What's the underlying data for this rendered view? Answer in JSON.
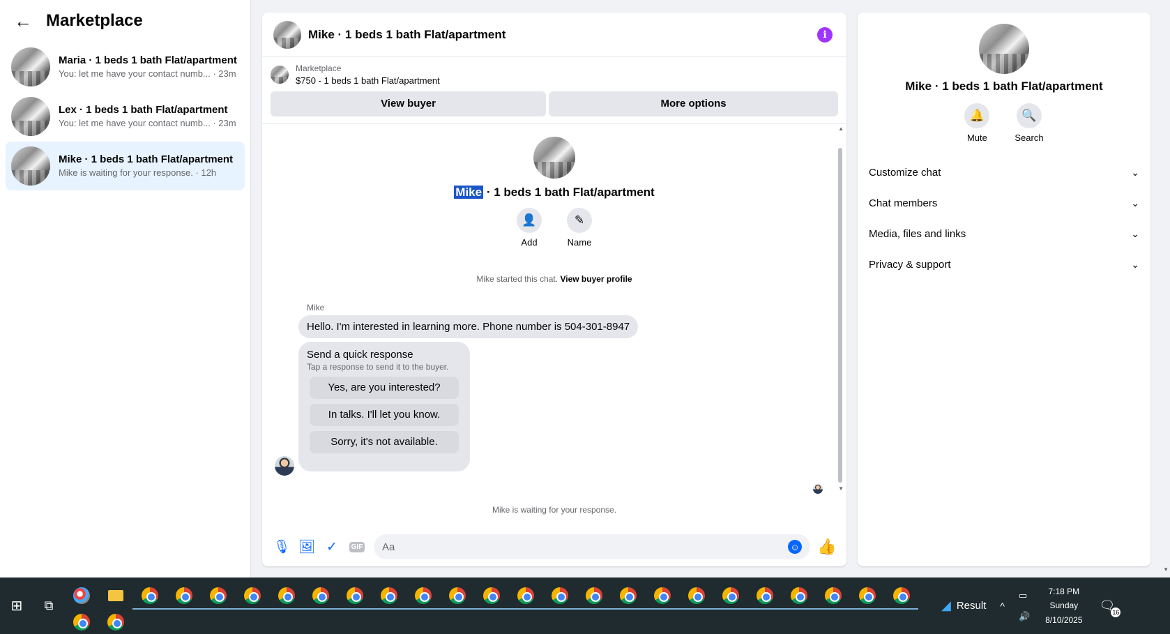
{
  "sidebar": {
    "title": "Marketplace",
    "conversations": [
      {
        "name": "Maria · 1 beds 1 bath Flat/apartment",
        "preview": "You: let me have your contact numb... · 23m"
      },
      {
        "name": "Lex · 1 beds 1 bath Flat/apartment",
        "preview": "You: let me have your contact numb... · 23m"
      },
      {
        "name": "Mike · 1 beds 1 bath Flat/apartment",
        "preview": "Mike is waiting for your response. · 12h"
      }
    ]
  },
  "chat": {
    "title": "Mike · 1 beds 1 bath Flat/apartment",
    "listing_label": "Marketplace",
    "listing_text": "$750 - 1 beds 1 bath Flat/apartment",
    "view_buyer": "View buyer",
    "more_options": "More options",
    "intro_name_highlight": "Mike",
    "intro_rest": " · 1 beds 1 bath Flat/apartment",
    "add_label": "Add",
    "name_label": "Name",
    "started_text": "Mike started this chat.",
    "view_profile": "View buyer profile",
    "sender": "Mike",
    "message": "Hello. I'm interested in learning more.  Phone number is 504-301-8947",
    "quick_title": "Send a quick response",
    "quick_sub": "Tap a response to send it to the buyer.",
    "quick_replies": [
      "Yes, are you interested?",
      "In talks. I'll let you know.",
      "Sorry, it's not available."
    ],
    "waiting": "Mike is waiting for your response.",
    "composer_placeholder": "Aa",
    "gif_label": "GIF"
  },
  "details": {
    "title": "Mike · 1 beds 1 bath Flat/apartment",
    "mute": "Mute",
    "search": "Search",
    "menu": [
      "Customize chat",
      "Chat members",
      "Media, files and links",
      "Privacy & support"
    ]
  },
  "taskbar": {
    "result_label": "Result",
    "time": "7:18 PM",
    "day": "Sunday",
    "date": "8/10/2025",
    "notification_count": "16"
  },
  "colors": {
    "accent": "#0866ff",
    "info": "#a033ff",
    "active_row": "#e7f3ff",
    "taskbar": "#1f2b2e"
  }
}
